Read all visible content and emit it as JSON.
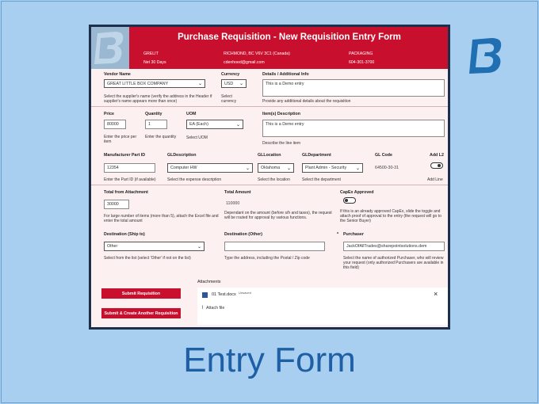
{
  "header": {
    "title": "Purchase Requisition - New Requisition Entry Form",
    "company": "GRELIT",
    "address": "RICHMOND, BC V6V 3C1 (Canada)",
    "department": "PACKAGING",
    "terms": "Net 30 Days",
    "email": "cdenhoed@gmail.com",
    "phone": "604-301-3700"
  },
  "vendor": {
    "label": "Vendor Name",
    "value": "GREAT LITTLE BOX COMPANY",
    "hint": "Select the supplier's name (verify the address in the Header if supplier's name appears more than once)"
  },
  "currency": {
    "label": "Currency",
    "value": "USD",
    "hint": "Select currency"
  },
  "details": {
    "label": "Details / Additional Info",
    "value": "This is a Demo entry",
    "hint": "Provide any additional details about the requisition"
  },
  "price": {
    "label": "Price",
    "value": "80000",
    "hint": "Enter the price per item"
  },
  "quantity": {
    "label": "Quantity",
    "value": "1",
    "hint": "Enter the quantity"
  },
  "uom": {
    "label": "UOM",
    "value": "EA (Each)",
    "hint": "Select UOM"
  },
  "item_desc": {
    "label": "Item(s) Description",
    "value": "This is a Demo entry",
    "hint": "Describe the line item"
  },
  "mfr_part": {
    "label": "Manufacturer Part ID",
    "value": "12354",
    "hint": "Enter the Part ID (if available)"
  },
  "gl_desc": {
    "label": "GLDescription",
    "value": "Computer HW",
    "hint": "Select the expense description"
  },
  "gl_location": {
    "label": "GLLocation",
    "value": "Oklahoma",
    "hint": "Select the location"
  },
  "gl_department": {
    "label": "GLDepartment",
    "value": "Plant Admin - Security",
    "hint": "Select the department"
  },
  "gl_code": {
    "label": "GL Code",
    "value": "64500-30-31"
  },
  "add_line": {
    "label": "Add L2",
    "hint": "Add Line"
  },
  "total_attachment": {
    "label": "Total from Attachment",
    "value": "30000",
    "hint": "For large number of items (more than 5), attach the Excel file and enter the total amount"
  },
  "total_amount": {
    "label": "Total Amount",
    "value": "110000",
    "hint": "Dependant on the amount (before s/h and taxes), the request will be routed for approval by various functions."
  },
  "capex": {
    "label": "CapEx Approved",
    "hint": "If this is an already approved CapEx, slide the toggle and attach proof of approval to the entry (the request will go to the Senior Buyer)"
  },
  "destination": {
    "label": "Destination (Ship to)",
    "value": "Other",
    "hint": "Select from the list (select 'Other' if not on the list)"
  },
  "destination_other": {
    "label": "Destination (Other)",
    "value": "",
    "hint": "Type the address, including the Postal / Zip code"
  },
  "purchaser": {
    "required_mark": "*",
    "label": "Purchaser",
    "value": "JackOfAllTrades@sharepointsolutions.dem",
    "hint": "Select the name of authorized Purchaser, who will review your request (only authorized Purchasers are available in this field)"
  },
  "attachments": {
    "label": "Attachments",
    "file_name": "01 Test.docx",
    "file_status": "Unsaved",
    "attach_label": "Attach file"
  },
  "buttons": {
    "submit": "Submit Requisition",
    "submit_another": "Submit & Create Another Requisition"
  },
  "slide_title": "Entry Form",
  "colors": {
    "brand_red": "#c8102e",
    "slide_blue": "#a9cff0",
    "logo_blue": "#1f6fb2"
  }
}
